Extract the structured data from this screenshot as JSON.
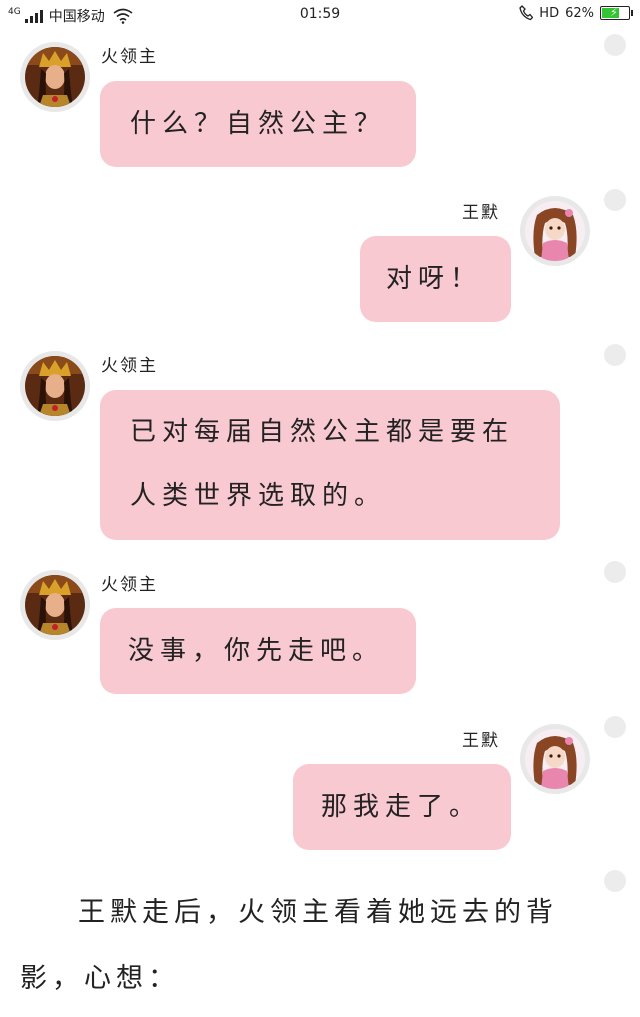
{
  "status_bar": {
    "network": "4G",
    "carrier": "中国移动",
    "time": "01:59",
    "hd": "HD",
    "battery_percent": "62%",
    "battery_level": 0.62,
    "icons": [
      "signal-icon",
      "wifi-icon",
      "phone-hd-icon",
      "battery-charging-icon"
    ]
  },
  "messages": [
    {
      "side": "left",
      "sender": "火领主",
      "text": "什么？自然公主？"
    },
    {
      "side": "right",
      "sender": "王默",
      "text": "对呀！"
    },
    {
      "side": "left",
      "sender": "火领主",
      "lines": [
        "已对每届自然公主都是要在",
        "人类世界选取的。"
      ]
    },
    {
      "side": "left",
      "sender": "火领主",
      "text": "没事，你先走吧。"
    },
    {
      "side": "right",
      "sender": "王默",
      "text": "那我走了。"
    }
  ],
  "narration": "王默走后，火领主看着她远去的背影，心想：",
  "colors": {
    "bubble": "#f9c9d2",
    "background": "#ffffff",
    "edge_dot": "#ececec"
  }
}
